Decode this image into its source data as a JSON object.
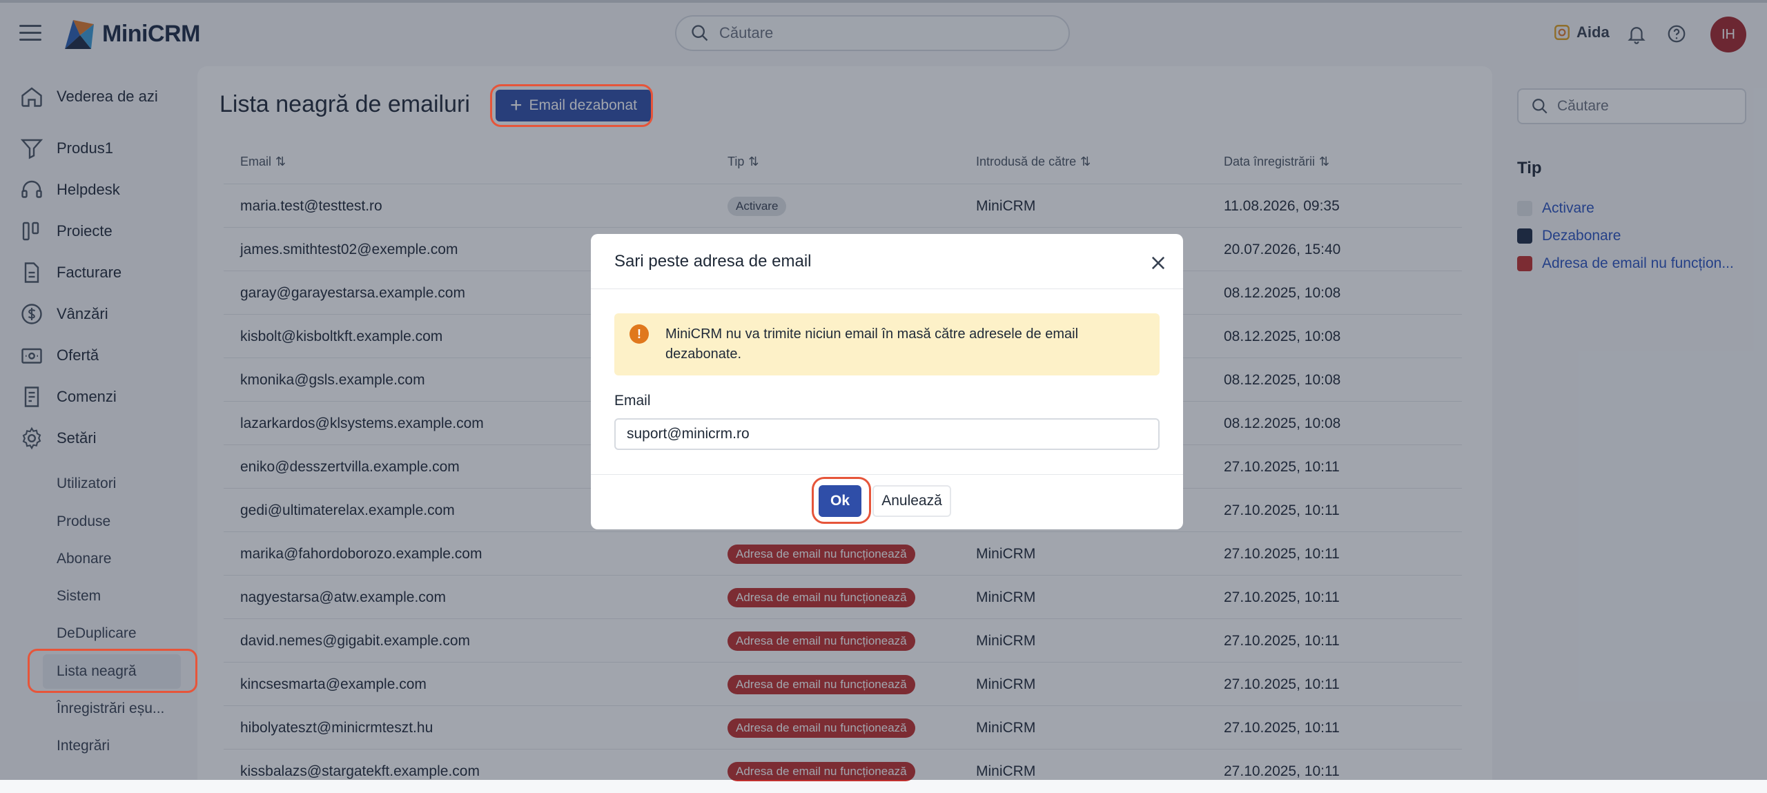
{
  "app": {
    "name": "MiniCRM"
  },
  "header": {
    "search_placeholder": "Căutare",
    "assistant_label": "Aida",
    "avatar_initials": "IH"
  },
  "sidebar": {
    "items": [
      {
        "label": "Vederea de azi",
        "icon": "home-icon"
      },
      {
        "label": "Produs1",
        "icon": "filter-icon"
      },
      {
        "label": "Helpdesk",
        "icon": "headset-icon"
      },
      {
        "label": "Proiecte",
        "icon": "columns-icon"
      },
      {
        "label": "Facturare",
        "icon": "document-icon"
      },
      {
        "label": "Vânzări",
        "icon": "dollar-icon"
      },
      {
        "label": "Ofertă",
        "icon": "offer-icon"
      },
      {
        "label": "Comenzi",
        "icon": "orders-icon"
      },
      {
        "label": "Setări",
        "icon": "gear-icon"
      }
    ],
    "sub_items": [
      "Utilizatori",
      "Produse",
      "Abonare",
      "Sistem",
      "DeDuplicare",
      "Lista neagră",
      "Înregistrări eșu...",
      "Integrări"
    ]
  },
  "main": {
    "title": "Lista neagră de emailuri",
    "add_button_label": "Email dezabonat",
    "columns": [
      "Email",
      "Tip",
      "Introdusă de către",
      "Data înregistrării"
    ],
    "rows": [
      {
        "email": "maria.test@testtest.ro",
        "tip": "Activare",
        "by": "MiniCRM",
        "date": "11.08.2026, 09:35"
      },
      {
        "email": "james.smithtest02@exemple.com",
        "tip": "",
        "by": "",
        "date": "20.07.2026, 15:40"
      },
      {
        "email": "garay@garayestarsa.example.com",
        "tip": "",
        "by": "",
        "date": "08.12.2025, 10:08"
      },
      {
        "email": "kisbolt@kisboltkft.example.com",
        "tip": "",
        "by": "",
        "date": "08.12.2025, 10:08"
      },
      {
        "email": "kmonika@gsls.example.com",
        "tip": "",
        "by": "",
        "date": "08.12.2025, 10:08"
      },
      {
        "email": "lazarkardos@klsystems.example.com",
        "tip": "",
        "by": "",
        "date": "08.12.2025, 10:08"
      },
      {
        "email": "eniko@desszertvilla.example.com",
        "tip": "",
        "by": "",
        "date": "27.10.2025, 10:11"
      },
      {
        "email": "gedi@ultimaterelax.example.com",
        "tip": "",
        "by": "",
        "date": "27.10.2025, 10:11"
      },
      {
        "email": "marika@fahordoborozo.example.com",
        "tip": "Adresa de email nu funcționează",
        "by": "MiniCRM",
        "date": "27.10.2025, 10:11"
      },
      {
        "email": "nagyestarsa@atw.example.com",
        "tip": "Adresa de email nu funcționează",
        "by": "MiniCRM",
        "date": "27.10.2025, 10:11"
      },
      {
        "email": "david.nemes@gigabit.example.com",
        "tip": "Adresa de email nu funcționează",
        "by": "MiniCRM",
        "date": "27.10.2025, 10:11"
      },
      {
        "email": "kincsesmarta@example.com",
        "tip": "Adresa de email nu funcționează",
        "by": "MiniCRM",
        "date": "27.10.2025, 10:11"
      },
      {
        "email": "hibolyateszt@minicrmteszt.hu",
        "tip": "Adresa de email nu funcționează",
        "by": "MiniCRM",
        "date": "27.10.2025, 10:11"
      },
      {
        "email": "kissbalazs@stargatekft.example.com",
        "tip": "Adresa de email nu funcționează",
        "by": "MiniCRM",
        "date": "27.10.2025, 10:11"
      }
    ]
  },
  "filter_panel": {
    "search_placeholder": "Căutare",
    "title": "Tip",
    "options": [
      {
        "label": "Activare",
        "color": "#dfe2e6"
      },
      {
        "label": "Dezabonare",
        "color": "#1c2a44"
      },
      {
        "label": "Adresa de email nu funcțion...",
        "color": "#c0302e"
      }
    ]
  },
  "modal": {
    "title": "Sari peste adresa de email",
    "alert": "MiniCRM nu va trimite niciun email în masă către adresele de email dezabonate.",
    "email_label": "Email",
    "email_value": "suport@minicrm.ro",
    "ok_label": "Ok",
    "cancel_label": "Anulează"
  },
  "colors": {
    "accent": "#2f4ea8",
    "highlight": "#e6553a",
    "danger": "#c0302e",
    "warning_bg": "#fdf1c8"
  }
}
